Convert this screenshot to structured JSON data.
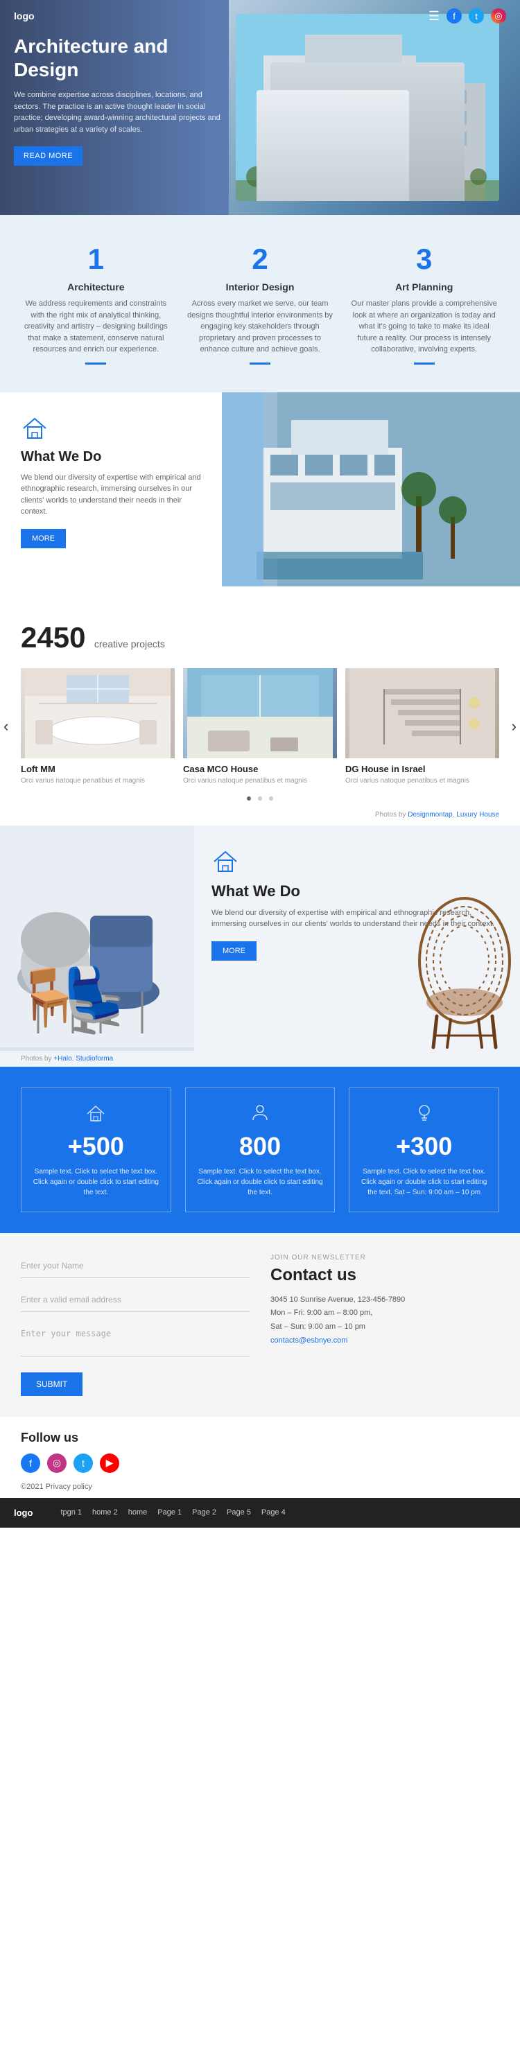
{
  "header": {
    "logo": "logo",
    "menu_icon": "☰",
    "fb_icon": "f",
    "tw_icon": "t",
    "ig_icon": "📷"
  },
  "hero": {
    "title": "Architecture and Design",
    "description": "We combine expertise across disciplines, locations, and sectors. The practice is an active thought leader in social practice; developing award-winning architectural projects and urban strategies at a variety of scales.",
    "btn_label": "READ MORE"
  },
  "features": [
    {
      "number": "1",
      "title": "Architecture",
      "description": "We address requirements and constraints with the right mix of analytical thinking, creativity and artistry – designing buildings that make a statement, conserve natural resources and enrich our experience."
    },
    {
      "number": "2",
      "title": "Interior Design",
      "description": "Across every market we serve, our team designs thoughtful interior environments by engaging key stakeholders through proprietary and proven processes to enhance culture and achieve goals."
    },
    {
      "number": "3",
      "title": "Art Planning",
      "description": "Our master plans provide a comprehensive look at where an organization is today and what it's going to take to make its ideal future a reality. Our process is intensely collaborative, involving experts."
    }
  ],
  "wwd1": {
    "title": "What We Do",
    "description": "We blend our diversity of expertise with empirical and ethnographic research, immersing ourselves in our clients' worlds to understand their needs in their context.",
    "btn_label": "MORE"
  },
  "projects": {
    "count": "2450",
    "label": "creative projects",
    "subtitle": ""
  },
  "carousel": {
    "items": [
      {
        "title": "Loft MM",
        "description": "Orci varius natoque penatibus et magnis"
      },
      {
        "title": "Casa MCO House",
        "description": "Orci varius natoque penatibus et magnis"
      },
      {
        "title": "DG House in Israel",
        "description": "Orci varius natoque penatibus et magnis"
      }
    ],
    "photos_credit": "Photos by Designmontap, Luxury House"
  },
  "wwd2": {
    "title": "What We Do",
    "description": "We blend our diversity of expertise with empirical and ethnographic research, immersing ourselves in our clients' worlds to understand their needs in their context.",
    "btn_label": "MORE",
    "photos_credit": "Photos by +Halo, Studioforma"
  },
  "stats": [
    {
      "num": "+500",
      "desc": "Sample text. Click to select the text box. Click again or double click to start editing the text."
    },
    {
      "num": "800",
      "desc": "Sample text. Click to select the text box. Click again or double click to start editing the text."
    },
    {
      "num": "+300",
      "desc": "Sample text. Click to select the text box. Click again or double click to start editing the text. Sat – Sun: 9:00 am – 10 pm"
    }
  ],
  "contact": {
    "newsletter_label": "JOIN OUR NEWSLETTER",
    "title": "Contact us",
    "address": "3045 10 Sunrise Avenue, 123-456-7890",
    "hours": "Mon – Fri: 9:00 am – 8:00 pm,",
    "hours2": "Sat – Sun: 9:00 am – 10 pm",
    "email": "contacts@esbnye.com",
    "form": {
      "name_placeholder": "Enter your Name",
      "email_placeholder": "Enter a valid email address",
      "message_placeholder": "Enter your message",
      "submit_label": "SUBMIT"
    }
  },
  "follow": {
    "title": "Follow us",
    "copyright": "©2021 Privacy policy"
  },
  "footer": {
    "logo": "logo",
    "nav": [
      "tpgn 1",
      "home 2",
      "home",
      "Page 1",
      "Page 2",
      "Page 5",
      "Page 4"
    ]
  }
}
